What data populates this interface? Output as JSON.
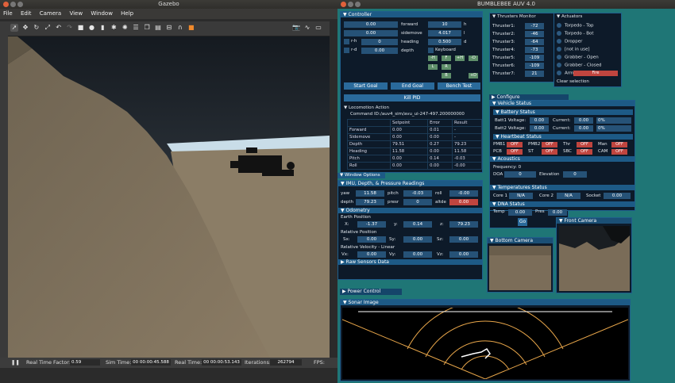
{
  "gazebo": {
    "title": "Gazebo",
    "menu": [
      "File",
      "Edit",
      "Camera",
      "View",
      "Window",
      "Help"
    ],
    "status": {
      "rtf_label": "Real Time Factor:",
      "rtf": "0.59",
      "sim_label": "Sim Time:",
      "sim": "00 00:00:45.588",
      "real_label": "Real Time:",
      "real": "00 00:00:53.143",
      "iter_label": "Iterations:",
      "iter": "262794",
      "fps_label": "FPS:"
    }
  },
  "app": {
    "title": "BUMBLEBEE AUV 4.0"
  },
  "controller": {
    "title": "Controller",
    "rows": [
      {
        "v": "0.00",
        "l": "forward",
        "v2": "10",
        "l2": "h"
      },
      {
        "v": "0.00",
        "l": "sidemove",
        "v2": "4.017",
        "l2": "l"
      },
      {
        "v": "0",
        "l": "heading",
        "v2": "0.500",
        "l2": "d"
      },
      {
        "v": "0.00",
        "l": "depth"
      }
    ],
    "toggles": [
      "r-h",
      "r-d"
    ],
    "keyboard": "Keyboard",
    "keys": [
      "-H",
      "F",
      "+H",
      "-D",
      "L",
      "R",
      "B",
      "+D"
    ],
    "buttons": [
      "Start Goal",
      "End Goal",
      "Bench Test"
    ],
    "kill": "Kill PID",
    "loco_title": "Locomotion Action",
    "command_label": "Command ID:",
    "command": "/auv4_sim/avu_ui-247-497.200000000",
    "table_head": [
      "",
      "Setpoint",
      "Error",
      "Result"
    ],
    "table": [
      [
        "Forward",
        "0.00",
        "0.01",
        "-"
      ],
      [
        "Sidemove",
        "0.00",
        "0.00",
        "-"
      ],
      [
        "Depth",
        "79.51",
        "0.27",
        "79.23"
      ],
      [
        "Heading",
        "11.58",
        "0.00",
        "11.58"
      ],
      [
        "Pitch",
        "0.00",
        "0.14",
        "-0.03"
      ],
      [
        "Roll",
        "0.00",
        "0.00",
        "-0.00"
      ]
    ]
  },
  "window_options": "Window Options",
  "imu": {
    "title": "IMU, Depth, & Pressure Readings",
    "r1": [
      {
        "l": "yaw",
        "v": "11.58"
      },
      {
        "l": "pitch",
        "v": "-0.03"
      },
      {
        "l": "roll",
        "v": "-0.00"
      }
    ],
    "r2": [
      {
        "l": "depth",
        "v": "79.23"
      },
      {
        "l": "presr",
        "v": "0"
      },
      {
        "l": "altde",
        "v": "0.00"
      }
    ]
  },
  "odometry": {
    "title": "Odometry",
    "earth": "Earth Position",
    "ex": {
      "l": "X:",
      "v": "-1.37"
    },
    "ey": {
      "l": "y:",
      "v": "0.14"
    },
    "ez": {
      "l": "z:",
      "v": "79.23"
    },
    "rel": "Relative Position",
    "sx": {
      "l": "Sx:",
      "v": "0.00"
    },
    "sy": {
      "l": "Sy:",
      "v": "0.00"
    },
    "sz": {
      "l": "Sz:",
      "v": "0.00"
    },
    "vel": "Relative Velocity - Linear",
    "vx": {
      "l": "Vx:",
      "v": "0.00"
    },
    "vy": {
      "l": "Vy:",
      "v": "0.00"
    },
    "vz": {
      "l": "Vz:",
      "v": "0.00"
    }
  },
  "raw": "Raw Sensors Data",
  "thrusters": {
    "title": "Thrusters Monitor",
    "items": [
      {
        "l": "Thruster1:",
        "v": "-72"
      },
      {
        "l": "Thruster2:",
        "v": "-46"
      },
      {
        "l": "Thruster3:",
        "v": "-64"
      },
      {
        "l": "Thruster4:",
        "v": "-73"
      },
      {
        "l": "Thruster5:",
        "v": "-109"
      },
      {
        "l": "Thruster6:",
        "v": "-109"
      },
      {
        "l": "Thruster7:",
        "v": "21"
      }
    ]
  },
  "actuators": {
    "title": "Actuators",
    "items": [
      "Torpedo - Top",
      "Torpedo - Bot",
      "Dropper",
      "[not in use]",
      "Grabber - Open",
      "Grabber - Closed"
    ],
    "arm": "Arm",
    "fire": "Fire",
    "clear": "Clear selection"
  },
  "configure": "Configure",
  "vehicle": {
    "title": "Vehicle Status",
    "battery": "Battery Status",
    "b1": {
      "l": "Batt1 Voltage:",
      "v": "0.00",
      "cl": "Current:",
      "c": "0.00",
      "p": "0%"
    },
    "b2": {
      "l": "Batt2 Voltage:",
      "v": "0.00",
      "cl": "Current:",
      "c": "0.00",
      "p": "0%"
    },
    "heartbeat": "Heartbeat Status",
    "hb1": [
      {
        "l": "PMB1",
        "v": "OFF"
      },
      {
        "l": "PMB2",
        "v": "OFF"
      },
      {
        "l": "Thr",
        "v": "OFF"
      },
      {
        "l": "Man",
        "v": "OFF"
      }
    ],
    "hb2": [
      {
        "l": "PCB",
        "v": "OFF"
      },
      {
        "l": "ST",
        "v": "OFF"
      },
      {
        "l": "SBC",
        "v": "OFF"
      },
      {
        "l": "CAM",
        "v": "OFF"
      }
    ],
    "acoustics": "Acoustics",
    "freq": "Frequency: 0",
    "doa": "DOA",
    "doa_v": "0",
    "elev": "Elevation",
    "elev_v": "0",
    "temps": "Temperatures Status",
    "core1": {
      "l": "Core 1",
      "v": "N/A"
    },
    "core2": {
      "l": "Core 2",
      "v": "N/A"
    },
    "socket": {
      "l": "Socket",
      "v": "0.00"
    },
    "dna": "DNA Status",
    "temp": {
      "l": "Temp",
      "v": "0.00"
    },
    "pres": {
      "l": "Pres",
      "v": "0.00"
    },
    "go": "Go"
  },
  "front_camera": "Front Camera",
  "bottom_camera": "Bottom Camera",
  "power": "Power Control",
  "sonar": "Sonar Image"
}
